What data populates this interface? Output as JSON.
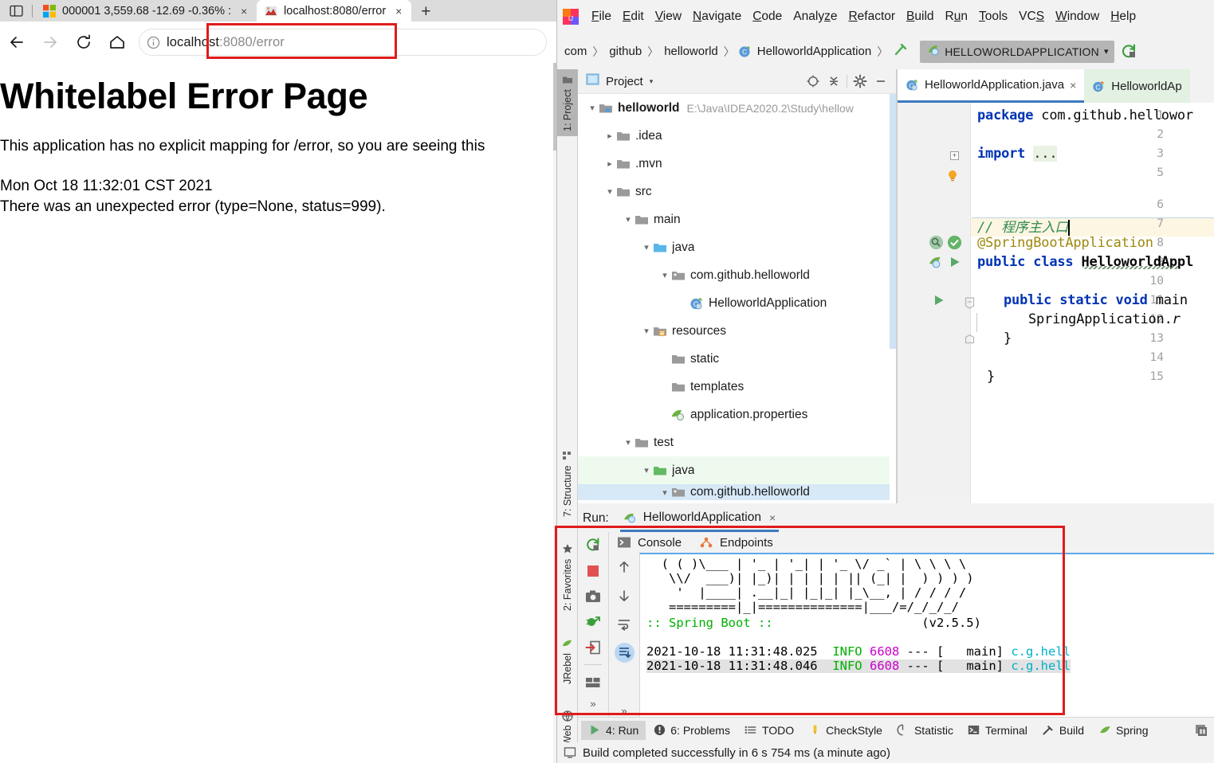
{
  "browser": {
    "tabs": [
      {
        "title": "000001 3,559.68 -12.69 -0.36% :",
        "favicon": "windows-icon",
        "active": false
      },
      {
        "title": "localhost:8080/error",
        "favicon": "page-icon",
        "active": true
      }
    ],
    "new_tab_label": "+",
    "close_label": "×",
    "nav": {
      "back": "back-arrow",
      "forward": "forward-arrow",
      "reload": "reload-arrow",
      "home": "home-icon"
    },
    "omnibox": {
      "url_host": "localhost",
      "url_rest": ":8080/error",
      "full_url": "localhost:8080/error",
      "info_icon": "info-circle-icon"
    },
    "page": {
      "heading": "Whitelabel Error Page",
      "paragraph1": "This application has no explicit mapping for /error, so you are seeing this",
      "timestamp": "Mon Oct 18 11:32:01 CST 2021",
      "error_line": "There was an unexpected error (type=None, status=999)."
    }
  },
  "ide": {
    "menu": [
      {
        "label": "File",
        "accel": "F"
      },
      {
        "label": "Edit",
        "accel": "E"
      },
      {
        "label": "View",
        "accel": "V"
      },
      {
        "label": "Navigate",
        "accel": "N"
      },
      {
        "label": "Code",
        "accel": "C"
      },
      {
        "label": "Analyze",
        "accel": "z"
      },
      {
        "label": "Refactor",
        "accel": "R"
      },
      {
        "label": "Build",
        "accel": "B"
      },
      {
        "label": "Run",
        "accel": "u"
      },
      {
        "label": "Tools",
        "accel": "T"
      },
      {
        "label": "VCS",
        "accel": "S"
      },
      {
        "label": "Window",
        "accel": "W"
      },
      {
        "label": "Help",
        "accel": "H"
      }
    ],
    "breadcrumbs": [
      "com",
      "github",
      "helloworld",
      "HelloworldApplication"
    ],
    "breadcrumb_sep": "〉",
    "run_config": {
      "name": "HELLOWORLDAPPLICATION",
      "caret": "▾"
    },
    "left_strip": [
      {
        "label": "1: Project",
        "icon": "folder-icon",
        "selected": true
      },
      {
        "label": "7: Structure",
        "icon": "structure-icon",
        "selected": false
      },
      {
        "label": "2: Favorites",
        "icon": "star-icon",
        "selected": false
      },
      {
        "label": "JRebel",
        "icon": "jrebel-icon",
        "selected": false
      },
      {
        "label": "Web",
        "icon": "web-icon",
        "selected": false
      }
    ],
    "project_panel": {
      "title": "Project",
      "caret": "▾",
      "header_icons": [
        "locate-icon",
        "collapse-all-icon",
        "gear-icon",
        "minimize-icon"
      ],
      "tree": [
        {
          "label": "helloworld",
          "path": "E:\\Java\\IDEA2020.2\\Study\\hellow",
          "depth": 0,
          "arrow": "down",
          "icon": "module-icon",
          "bold": true,
          "row": "normal"
        },
        {
          "label": ".idea",
          "path": "",
          "depth": 1,
          "arrow": "right",
          "icon": "folder-icon",
          "bold": false,
          "row": "normal"
        },
        {
          "label": ".mvn",
          "path": "",
          "depth": 1,
          "arrow": "right",
          "icon": "folder-icon",
          "bold": false,
          "row": "normal"
        },
        {
          "label": "src",
          "path": "",
          "depth": 1,
          "arrow": "down",
          "icon": "folder-icon",
          "bold": false,
          "row": "normal"
        },
        {
          "label": "main",
          "path": "",
          "depth": 2,
          "arrow": "down",
          "icon": "folder-icon",
          "bold": false,
          "row": "normal"
        },
        {
          "label": "java",
          "path": "",
          "depth": 3,
          "arrow": "down",
          "icon": "source-folder-icon",
          "bold": false,
          "row": "normal"
        },
        {
          "label": "com.github.helloworld",
          "path": "",
          "depth": 4,
          "arrow": "down",
          "icon": "package-icon",
          "bold": false,
          "row": "normal"
        },
        {
          "label": "HelloworldApplication",
          "path": "",
          "depth": 5,
          "arrow": "none",
          "icon": "spring-class-icon",
          "bold": false,
          "row": "normal"
        },
        {
          "label": "resources",
          "path": "",
          "depth": 3,
          "arrow": "down",
          "icon": "resources-folder-icon",
          "bold": false,
          "row": "normal"
        },
        {
          "label": "static",
          "path": "",
          "depth": 4,
          "arrow": "none",
          "icon": "folder-icon",
          "bold": false,
          "row": "normal"
        },
        {
          "label": "templates",
          "path": "",
          "depth": 4,
          "arrow": "none",
          "icon": "folder-icon",
          "bold": false,
          "row": "normal"
        },
        {
          "label": "application.properties",
          "path": "",
          "depth": 4,
          "arrow": "none",
          "icon": "spring-properties-icon",
          "bold": false,
          "row": "normal"
        },
        {
          "label": "test",
          "path": "",
          "depth": 2,
          "arrow": "down",
          "icon": "folder-icon",
          "bold": false,
          "row": "normal"
        },
        {
          "label": "java",
          "path": "",
          "depth": 3,
          "arrow": "down",
          "icon": "test-source-folder-icon",
          "bold": false,
          "row": "green"
        },
        {
          "label": "com.github.helloworld",
          "path": "",
          "depth": 4,
          "arrow": "down",
          "icon": "package-icon",
          "bold": false,
          "row": "selected"
        }
      ]
    },
    "editor": {
      "tabs": [
        {
          "label": "HelloworldApplication.java",
          "icon": "spring-class-icon",
          "close": "×",
          "state": "active"
        },
        {
          "label": "HelloworldAp",
          "icon": "class-icon",
          "close": "",
          "state": "green"
        }
      ],
      "lines": [
        {
          "num": "1",
          "text": "package com.github.hellowor"
        },
        {
          "num": "2",
          "text": ""
        },
        {
          "num": "3",
          "text": "import ..."
        },
        {
          "num": "5",
          "text": ""
        },
        {
          "num": "6",
          "text": "// 程序主入口"
        },
        {
          "num": "7",
          "text": "@SpringBootApplication"
        },
        {
          "num": "8",
          "text": "public class HelloworldAppl"
        },
        {
          "num": "9",
          "text": ""
        },
        {
          "num": "10",
          "text": "    public static void main"
        },
        {
          "num": "11",
          "text": "        SpringApplication.r"
        },
        {
          "num": "12",
          "text": "    }"
        },
        {
          "num": "13",
          "text": ""
        },
        {
          "num": "14",
          "text": "}"
        },
        {
          "num": "15",
          "text": ""
        }
      ],
      "import_ellipsis": "...",
      "comment_text": "// 程序主入口"
    },
    "run_panel": {
      "label": "Run:",
      "tab_name": "HelloworldApplication",
      "tab_close": "×",
      "toolbar_icons": [
        "rerun-icon",
        "stop-icon",
        "screenshot-icon",
        "debug-attach-icon",
        "import-icon",
        "layout-icon",
        "more-icon"
      ],
      "console_tabs": [
        {
          "label": "Console",
          "icon": "console-icon"
        },
        {
          "label": "Endpoints",
          "icon": "endpoints-icon"
        }
      ],
      "console_side_icons": [
        "up-arrow-icon",
        "down-arrow-icon",
        "soft-wrap-icon",
        "scroll-to-end-icon",
        "more-icon"
      ],
      "banner": [
        "  ( ( )\\___ | '_ | '_| | '_ \\/ _` | \\ \\ \\ \\",
        "   \\\\/  ___)| |_)| | | | | || (_| |  ) ) ) )",
        "    '  |____| .__|_| |_|_| |_\\__, | / / / /",
        "   =========|_|==============|___/=/_/_/_/"
      ],
      "banner_title": ":: Spring Boot ::",
      "banner_version": "(v2.5.5)",
      "log_lines": [
        {
          "ts": "2021-10-18 11:31:48.025",
          "level": "INFO",
          "pid": "6608",
          "dashes": "--- [",
          "thread": "main]",
          "logger": "c.g.hell"
        },
        {
          "ts": "2021-10-18 11:31:48.046",
          "level": "INFO",
          "pid": "6608",
          "dashes": "--- [",
          "thread": "main]",
          "logger": "c.g.hell"
        }
      ]
    },
    "tool_buttons": [
      {
        "label": "4: Run",
        "icon": "run-icon",
        "selected": true
      },
      {
        "label": "6: Problems",
        "icon": "problems-icon",
        "selected": false
      },
      {
        "label": "TODO",
        "icon": "todo-icon",
        "selected": false
      },
      {
        "label": "CheckStyle",
        "icon": "checkstyle-icon",
        "selected": false
      },
      {
        "label": "Statistic",
        "icon": "statistic-icon",
        "selected": false
      },
      {
        "label": "Terminal",
        "icon": "terminal-icon",
        "selected": false
      },
      {
        "label": "Build",
        "icon": "build-icon",
        "selected": false
      },
      {
        "label": "Spring",
        "icon": "spring-icon",
        "selected": false
      }
    ],
    "status_bar": {
      "message": "Build completed successfully in 6 s 754 ms (a minute ago)",
      "icon": "build-status-icon"
    }
  },
  "colors": {
    "annotation_red": "#e01b1b",
    "ide_bg": "#f2f2f2",
    "accent_blue": "#3e7ac0",
    "console_green": "#00b000",
    "console_magenta": "#cc00cc",
    "console_cyan": "#00b0c8"
  }
}
